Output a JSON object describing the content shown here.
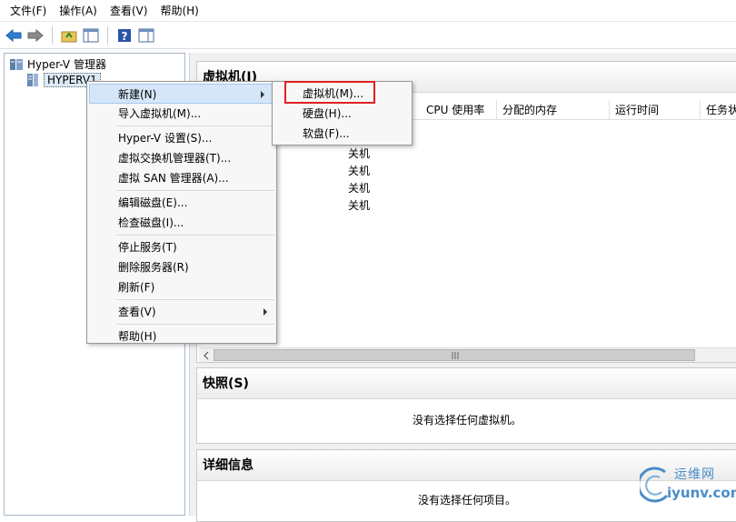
{
  "menubar": {
    "items": [
      "文件(F)",
      "操作(A)",
      "查看(V)",
      "帮助(H)"
    ]
  },
  "toolbar": {
    "icons": [
      "back-arrow-icon",
      "forward-arrow-icon",
      "up-folder-icon",
      "show-hide-tree-icon",
      "help-icon",
      "action-pane-icon"
    ]
  },
  "tree": {
    "root": "Hyper-V 管理器",
    "server": "HYPERV1"
  },
  "vm_panel": {
    "title": "虚拟机(I)",
    "columns": [
      "CPU 使用率",
      "分配的内存",
      "运行时间",
      "任务状"
    ],
    "states": [
      "关机",
      "关机",
      "关机",
      "关机"
    ]
  },
  "snapshot_panel": {
    "title": "快照(S)",
    "empty": "没有选择任何虚拟机。"
  },
  "details_panel": {
    "title": "详细信息",
    "empty": "没有选择任何项目。"
  },
  "context_menu": {
    "items": [
      {
        "label": "新建(N)"
      },
      {
        "label": "导入虚拟机(M)..."
      },
      {
        "label": "Hyper-V 设置(S)..."
      },
      {
        "label": "虚拟交换机管理器(T)..."
      },
      {
        "label": "虚拟 SAN 管理器(A)..."
      },
      {
        "label": "编辑磁盘(E)..."
      },
      {
        "label": "检查磁盘(I)..."
      },
      {
        "label": "停止服务(T)"
      },
      {
        "label": "删除服务器(R)"
      },
      {
        "label": "刷新(F)"
      },
      {
        "label": "查看(V)"
      },
      {
        "label": "帮助(H)"
      }
    ]
  },
  "submenu": {
    "items": [
      "虚拟机(M)...",
      "硬盘(H)...",
      "软盘(F)..."
    ]
  },
  "watermark": {
    "title": "运维网",
    "url": "iyunv.com"
  },
  "colors": {
    "highlight": "#d5e6f8",
    "redbox": "#e02020"
  }
}
